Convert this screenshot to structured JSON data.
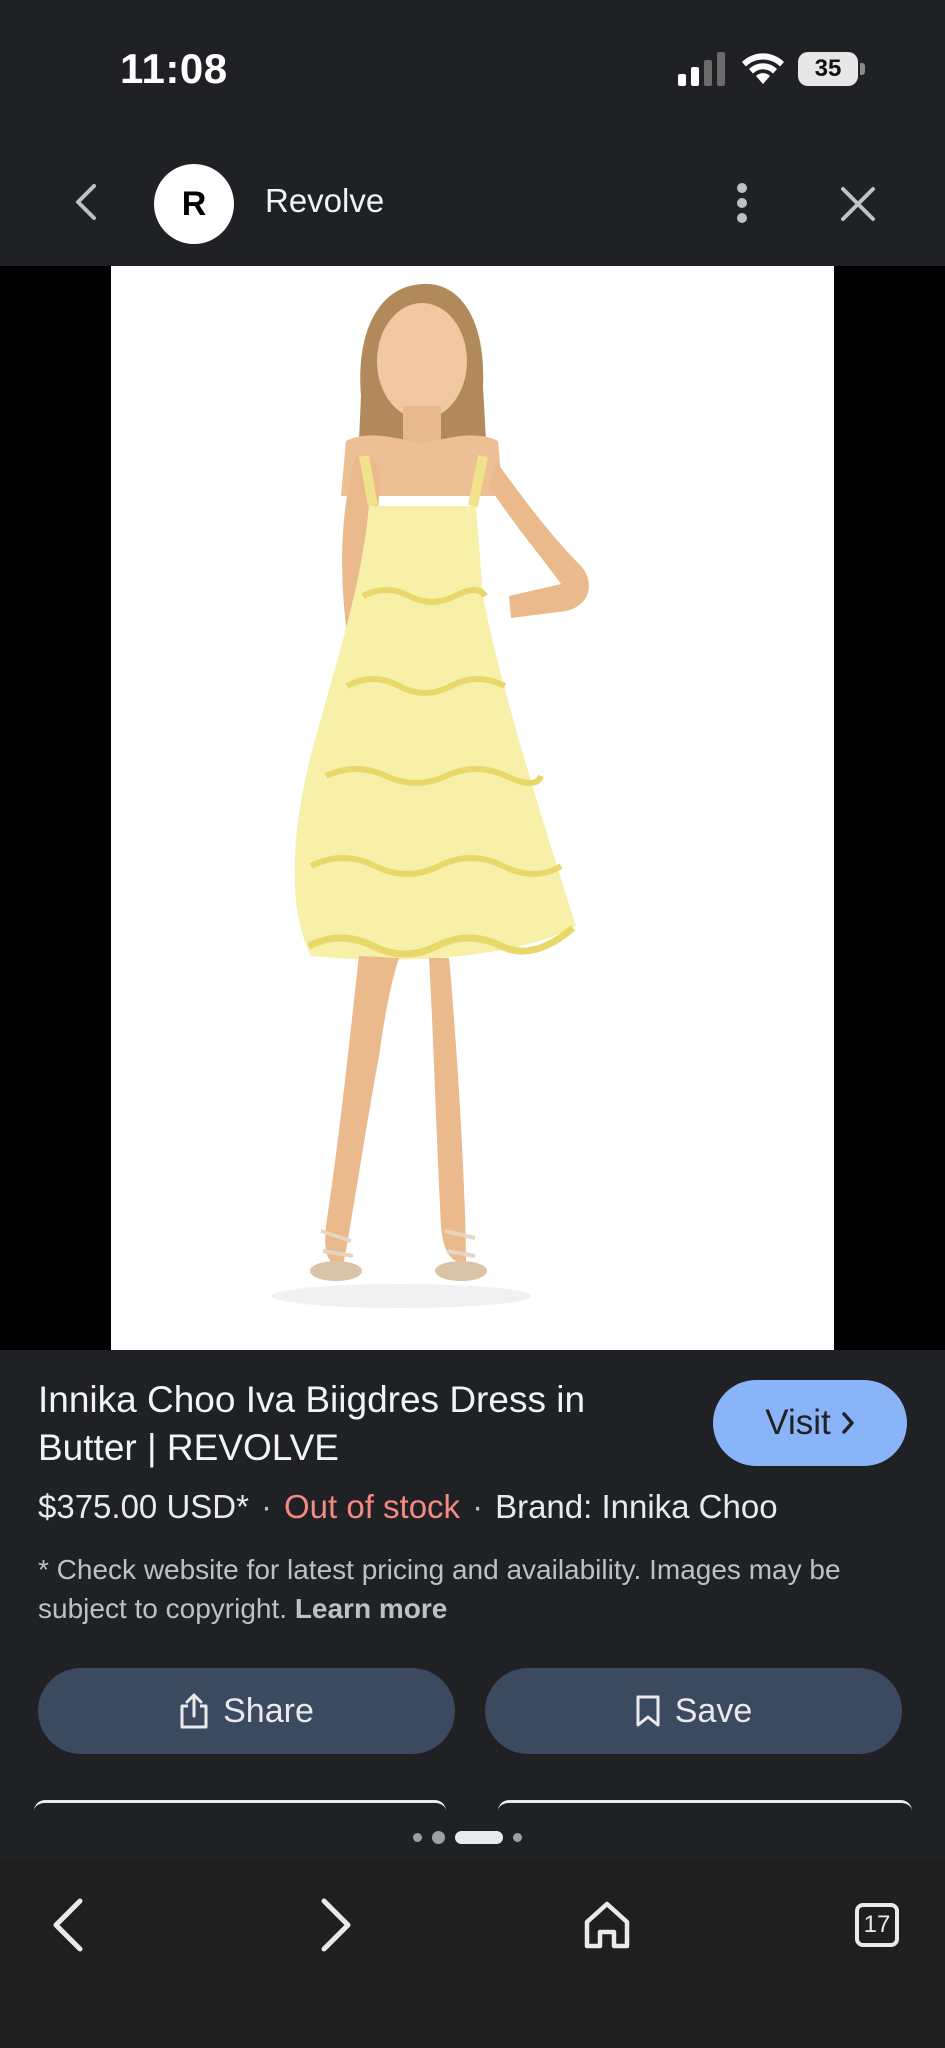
{
  "status_bar": {
    "time": "11:08",
    "battery": "35"
  },
  "header": {
    "site_initial": "R",
    "site_name": "Revolve"
  },
  "product": {
    "title": "Innika Choo Iva Biigdres Dress in Butter | REVOLVE",
    "price": "$375.00 USD*",
    "separator": "·",
    "stock": "Out of stock",
    "brand": "Brand: Innika Choo",
    "disclaimer": "* Check website for latest pricing and availability. Images may be subject to copyright.",
    "learn_more": "Learn more"
  },
  "visit_button": {
    "label": "Visit"
  },
  "actions": {
    "share_label": "Share",
    "save_label": "Save"
  },
  "bottom_nav": {
    "tab_count": "17"
  },
  "colors": {
    "background": "#202124",
    "visit_accent": "#8ab4f8",
    "out_of_stock": "#f28b82",
    "action_button": "#3c4a60",
    "dress": "#f7f0a8"
  },
  "icons": [
    "back-icon",
    "more-vert-icon",
    "close-icon",
    "chevron-right-icon",
    "share-icon",
    "bookmark-icon",
    "nav-back-icon",
    "nav-forward-icon",
    "home-icon",
    "tabs-icon"
  ]
}
